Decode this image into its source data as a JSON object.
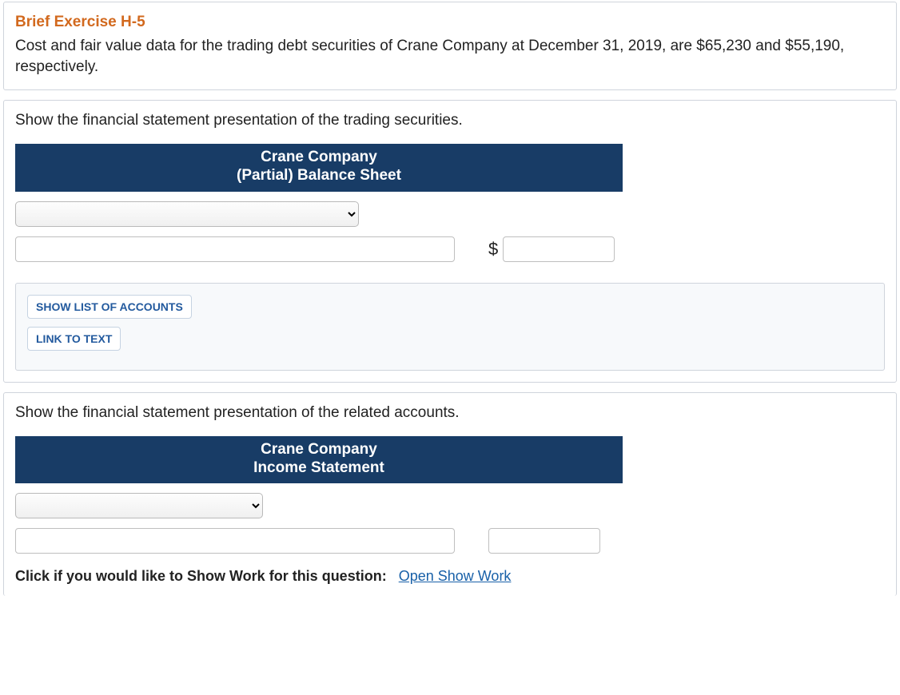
{
  "header": {
    "title": "Brief Exercise H-5",
    "problem": "Cost and fair value data for the trading debt securities of Crane Company at December 31, 2019, are $65,230 and $55,190, respectively."
  },
  "part1": {
    "instruction": "Show the financial statement presentation of the trading securities.",
    "banner_line1": "Crane Company",
    "banner_line2": "(Partial) Balance Sheet",
    "dropdown_value": "",
    "text1_value": "",
    "currency_symbol": "$",
    "amount_value": "",
    "btn_accounts": "SHOW LIST OF ACCOUNTS",
    "btn_link": "LINK TO TEXT"
  },
  "part2": {
    "instruction": "Show the financial statement presentation of the related accounts.",
    "banner_line1": "Crane Company",
    "banner_line2": "Income Statement",
    "dropdown_value": "",
    "text1_value": "",
    "amount_value": "",
    "showwork_label": "Click if you would like to Show Work for this question:",
    "showwork_link": "Open Show Work"
  }
}
